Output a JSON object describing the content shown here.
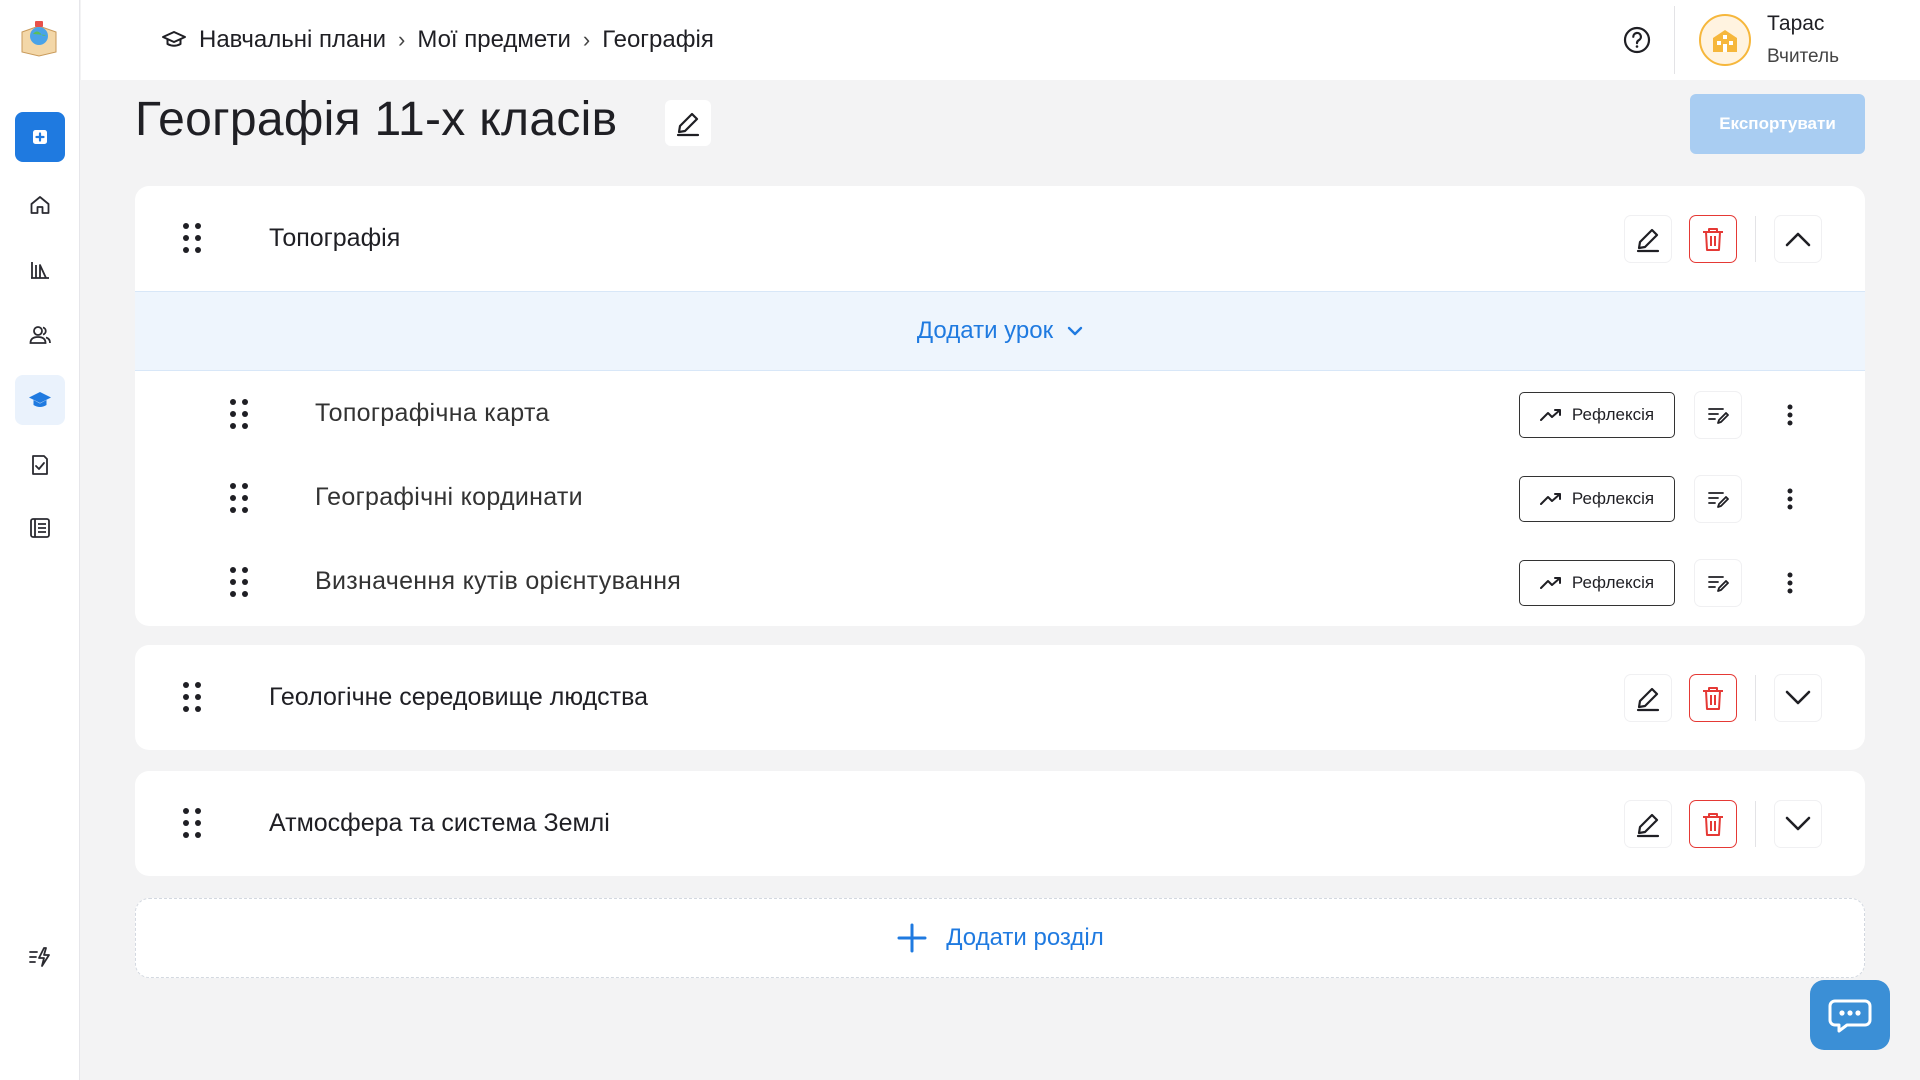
{
  "breadcrumb": {
    "items": [
      "Навчальні плани",
      "Мої предмети",
      "Географія"
    ],
    "separator": "›"
  },
  "user": {
    "name": "Тарас",
    "role": "Вчитель"
  },
  "page": {
    "title": "Географія 11-х класів",
    "export_label": "Експортувати"
  },
  "sections": [
    {
      "title": "Топографія",
      "expanded": true,
      "add_lesson_label": "Додати урок",
      "lessons": [
        {
          "title": "Топографічна карта",
          "reflex_label": "Рефлексія"
        },
        {
          "title": "Географічні кординати",
          "reflex_label": "Рефлексія"
        },
        {
          "title": "Визначення кутів орієнтування",
          "reflex_label": "Рефлексія"
        }
      ]
    },
    {
      "title": "Геологічне середовище людства",
      "expanded": false
    },
    {
      "title": "Атмосфера та система Землі",
      "expanded": false
    }
  ],
  "add_section_label": "Додати розділ",
  "colors": {
    "accent": "#1f7ae0",
    "danger": "#e53935",
    "export_disabled": "#a9cdf2",
    "chat": "#3b8fd6"
  },
  "icons": {
    "sidebar": [
      "logo-icon",
      "add-icon",
      "home-icon",
      "library-icon",
      "users-icon",
      "graduation-cap-icon",
      "task-check-icon",
      "journal-icon",
      "quick-actions-icon"
    ]
  }
}
